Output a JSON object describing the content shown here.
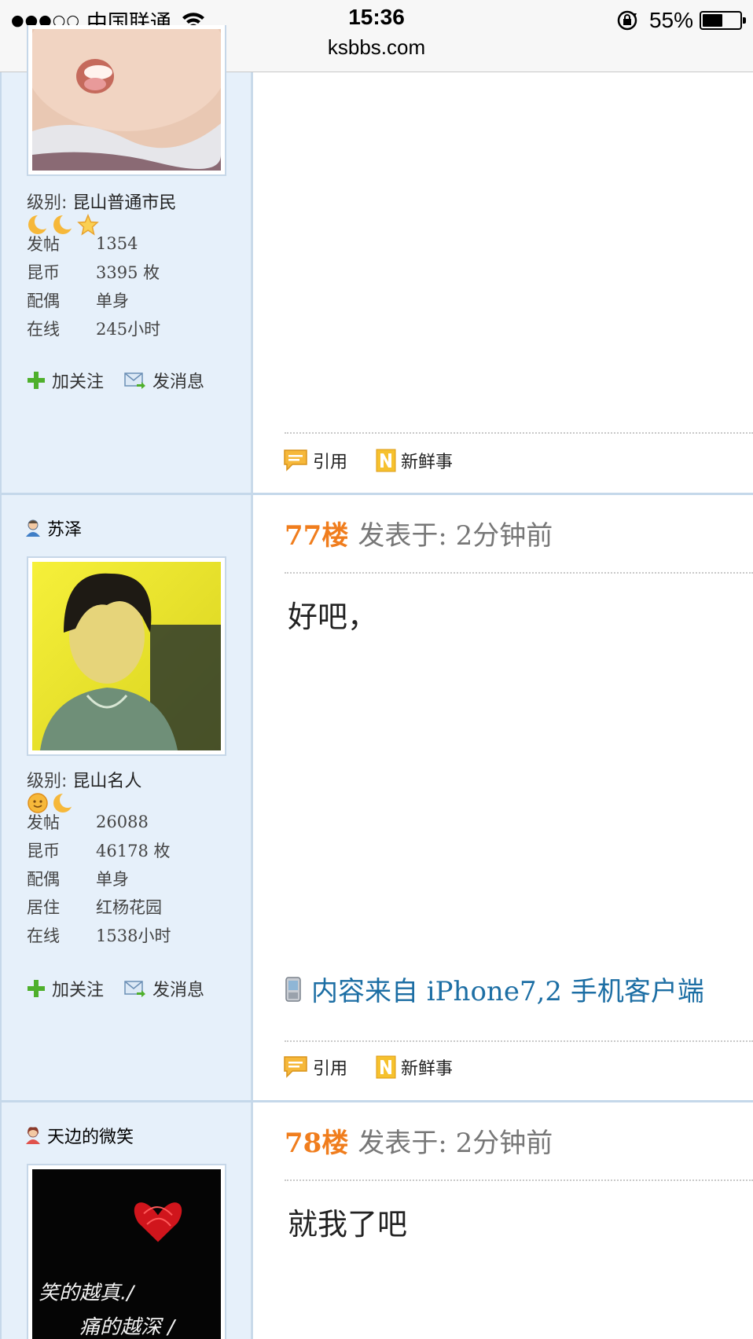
{
  "status_bar": {
    "signal_dots": "●●●○○",
    "carrier": "中国联通",
    "time": "15:36",
    "url": "ksbbs.com",
    "battery": "55%",
    "battery_level": 0.55
  },
  "posts": [
    {
      "user": {
        "level_label": "级别:",
        "level_name": "昆山普通市民",
        "rank_icons": [
          "moon-icon",
          "moon-icon",
          "star-icon"
        ],
        "stats": [
          {
            "key": "发帖",
            "value": "1354"
          },
          {
            "key": "昆币",
            "value": "3395 枚"
          },
          {
            "key": "配偶",
            "value": "单身"
          },
          {
            "key": "在线",
            "value": "245小时"
          }
        ],
        "follow_label": "加关注",
        "message_label": "发消息"
      },
      "actions": {
        "quote": "引用",
        "news": "新鲜事"
      }
    },
    {
      "user": {
        "name": "苏泽",
        "gender": "male",
        "level_label": "级别:",
        "level_name": "昆山名人",
        "rank_icons": [
          "sun-icon",
          "moon-icon"
        ],
        "stats": [
          {
            "key": "发帖",
            "value": "26088"
          },
          {
            "key": "昆币",
            "value": "46178 枚"
          },
          {
            "key": "配偶",
            "value": "单身"
          },
          {
            "key": "居住",
            "value": "红杨花园"
          },
          {
            "key": "在线",
            "value": "1538小时"
          }
        ],
        "follow_label": "加关注",
        "message_label": "发消息"
      },
      "floor": "77楼",
      "posted": "发表于: 2分钟前",
      "body": "好吧，",
      "client_note": "内容来自 iPhone7,2 手机客户端",
      "actions": {
        "quote": "引用",
        "news": "新鲜事"
      }
    },
    {
      "user": {
        "name": "天边的微笑",
        "gender": "female",
        "avatar_text_1": "笑的越真./",
        "avatar_text_2": "痛的越深 /"
      },
      "floor": "78楼",
      "posted": "发表于: 2分钟前",
      "body": "就我了吧"
    }
  ],
  "colors": {
    "sidebar_bg": "#e6f0fa",
    "floor_orange": "#f07d1d",
    "link_blue": "#1c6ea4"
  }
}
